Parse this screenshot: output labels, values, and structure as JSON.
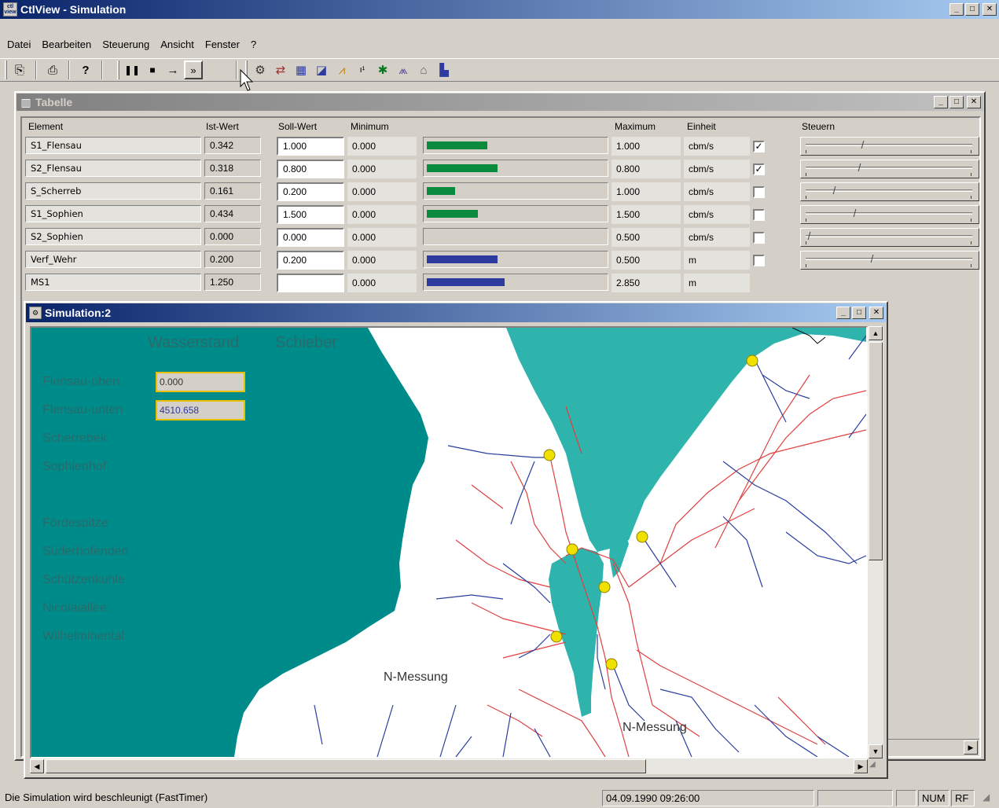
{
  "app": {
    "title": "CtlView - Simulation",
    "icon_label": "ctl view"
  },
  "menu": [
    "Datei",
    "Bearbeiten",
    "Steuerung",
    "Ansicht",
    "Fenster",
    "?"
  ],
  "toolbar": {
    "icons": [
      "copy-icon",
      "print-icon",
      "help-icon",
      "pause-icon",
      "stop-icon",
      "step-icon",
      "fast-forward-icon",
      "network-icon",
      "flow-icon",
      "table-icon",
      "diagram-icon",
      "chart-icon",
      "signal-icon",
      "traffic-light-icon",
      "graph-icon",
      "building-icon",
      "bar-chart-icon"
    ]
  },
  "tabelle": {
    "title": "Tabelle",
    "headers": {
      "element": "Element",
      "ist": "Ist-Wert",
      "soll": "Soll-Wert",
      "min": "Minimum",
      "max": "Maximum",
      "einheit": "Einheit",
      "steuern": "Steuern"
    },
    "rows": [
      {
        "element": "S1_Flensau",
        "ist": "0.342",
        "soll": "1.000",
        "min": "0.000",
        "max": "1.000",
        "einheit": "cbm/s",
        "checked": true,
        "level": 0.342,
        "slider": 0.342,
        "bar_color": "#0a8a3c",
        "has_control": true
      },
      {
        "element": "S2_Flensau",
        "ist": "0.318",
        "soll": "0.800",
        "min": "0.000",
        "max": "0.800",
        "einheit": "cbm/s",
        "checked": true,
        "level": 0.397,
        "slider": 0.318,
        "bar_color": "#0a8a3c",
        "has_control": true
      },
      {
        "element": "S_Scherreb",
        "ist": "0.161",
        "soll": "0.200",
        "min": "0.000",
        "max": "1.000",
        "einheit": "cbm/s",
        "checked": false,
        "level": 0.161,
        "slider": 0.161,
        "bar_color": "#0a8a3c",
        "has_control": true
      },
      {
        "element": "S1_Sophien",
        "ist": "0.434",
        "soll": "1.500",
        "min": "0.000",
        "max": "1.500",
        "einheit": "cbm/s",
        "checked": false,
        "level": 0.289,
        "slider": 0.289,
        "bar_color": "#0a8a3c",
        "has_control": true
      },
      {
        "element": "S2_Sophien",
        "ist": "0.000",
        "soll": "0.000",
        "min": "0.000",
        "max": "0.500",
        "einheit": "cbm/s",
        "checked": false,
        "level": 0.0,
        "slider": 0.0,
        "bar_color": "#0a8a3c",
        "has_control": true
      },
      {
        "element": "Verf_Wehr",
        "ist": "0.200",
        "soll": "0.200",
        "min": "0.000",
        "max": "0.500",
        "einheit": "m",
        "checked": false,
        "level": 0.4,
        "slider": 0.4,
        "bar_color": "#2e3a9e",
        "has_control": true
      },
      {
        "element": "MS1",
        "ist": "1.250",
        "soll": "",
        "min": "0.000",
        "max": "2.850",
        "einheit": "m",
        "checked": false,
        "level": 0.439,
        "slider": 0.0,
        "bar_color": "#2e3a9e",
        "has_control": false
      }
    ]
  },
  "simulation": {
    "title": "Simulation:2",
    "header_labels": [
      "Wasserstand",
      "Schieber"
    ],
    "stations": [
      {
        "label": "Flensau-oben",
        "value": "0.000"
      },
      {
        "label": "Flensau-unten",
        "value": "4510.658"
      },
      {
        "label": "Scherrebek",
        "value": null
      },
      {
        "label": "Sophienhof",
        "value": null
      },
      {
        "label": "Fördespitze",
        "value": null
      },
      {
        "label": "Süderhofenden",
        "value": null
      },
      {
        "label": "Schützenkuhle",
        "value": null
      },
      {
        "label": "Nicolaiallee",
        "value": null
      },
      {
        "label": "Wilhelminental",
        "value": null
      }
    ],
    "map_labels": [
      "N-Messung",
      "N-Messung"
    ],
    "colors": {
      "water": "#2eb3ad",
      "land_left": "#008b8b",
      "red_line": "#e04040",
      "blue_line": "#2a3e9e",
      "node": "#f0e000"
    }
  },
  "status": {
    "message": "Die Simulation wird beschleunigt (FastTimer)",
    "datetime": "04.09.1990 09:26:00",
    "num": "NUM",
    "rf": "RF"
  }
}
